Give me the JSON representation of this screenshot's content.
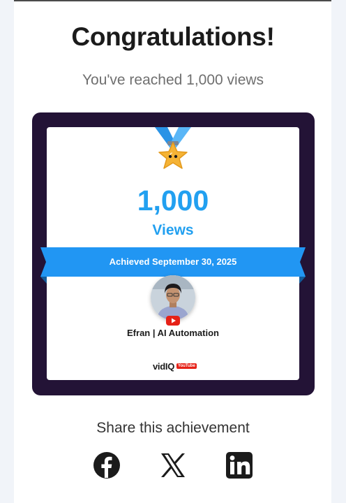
{
  "header": {
    "title": "Congratulations!",
    "subtitle": "You've reached 1,000 views"
  },
  "card": {
    "views_number": "1,000",
    "views_label": "Views",
    "achieved_text": "Achieved September 30, 2025",
    "channel_name": "Efran | AI Automation",
    "brand": "vidIQ",
    "brand_badge": "YouTube"
  },
  "share": {
    "label": "Share this achievement",
    "icons": [
      "facebook-icon",
      "x-icon",
      "linkedin-icon"
    ]
  },
  "colors": {
    "accent_blue": "#22a0f0",
    "card_frame": "#231336",
    "medal_gold": "#f5b335",
    "ribbon_blue": "#2196f3"
  }
}
